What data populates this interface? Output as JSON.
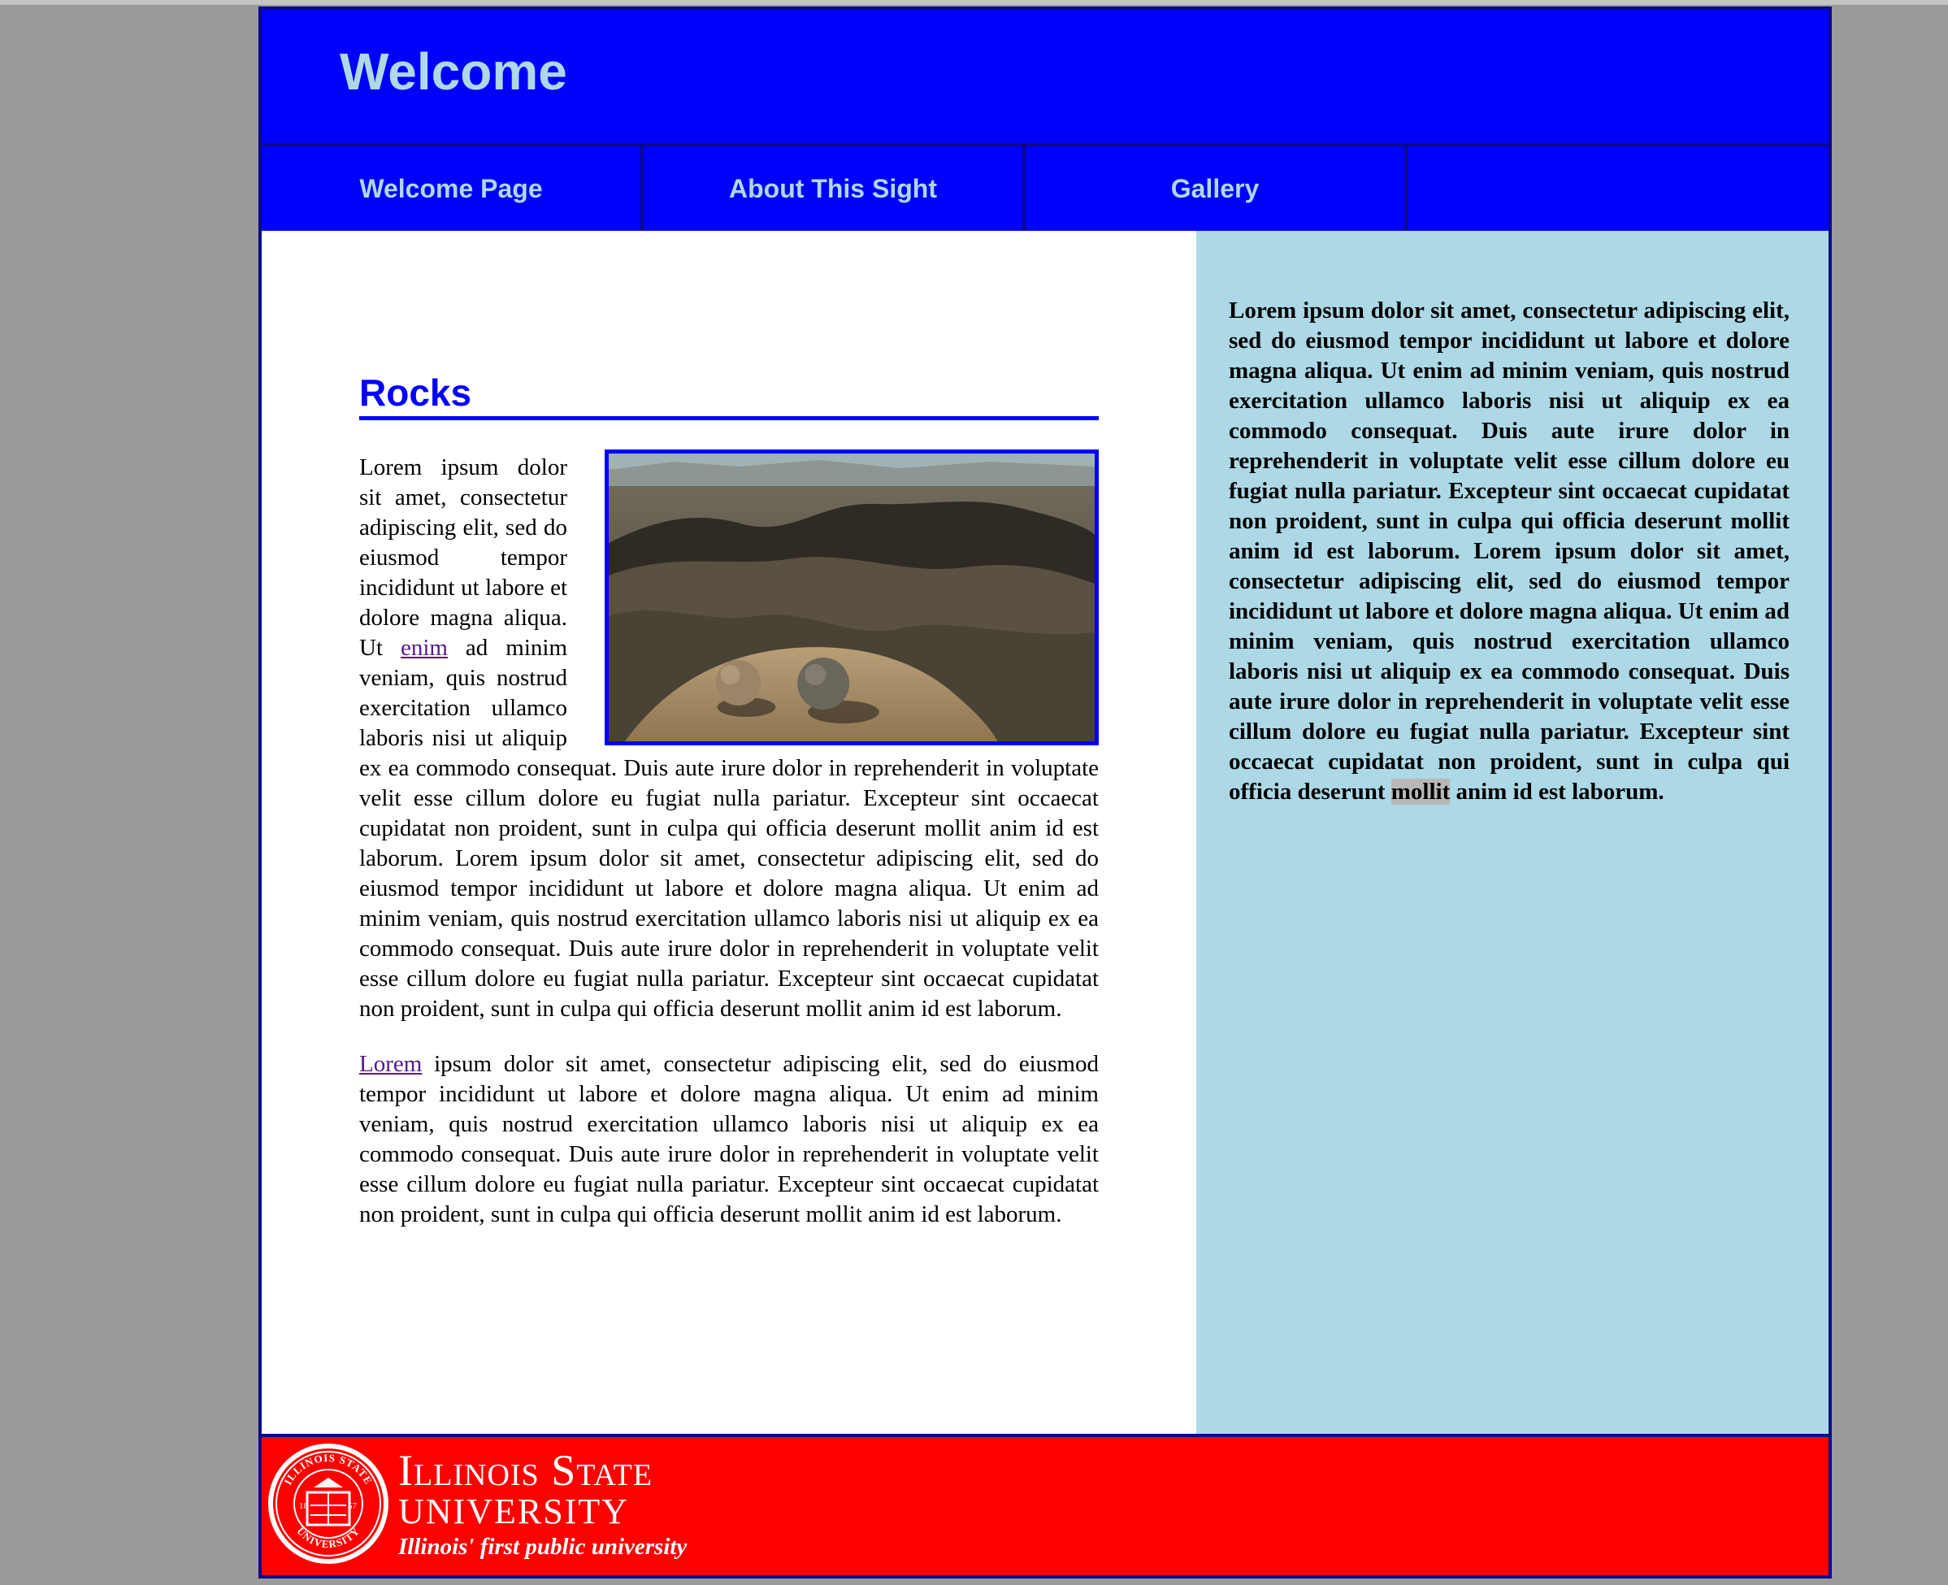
{
  "header": {
    "title": "Welcome"
  },
  "nav": {
    "items": [
      {
        "label": "Welcome Page"
      },
      {
        "label": "About This Sight"
      },
      {
        "label": "Gallery"
      },
      {
        "label": ""
      }
    ]
  },
  "article": {
    "heading": "Rocks",
    "image_alt": "desert badlands with two round rocks",
    "p1": {
      "before_link": "Lorem ipsum dolor sit amet, consectetur adipiscing elit, sed do eiusmod tempor incididunt ut labore et dolore magna aliqua. Ut ",
      "link": "enim",
      "after_link": " ad minim veniam, quis nostrud exercitation ullamco laboris nisi ut aliquip ex ea commodo consequat. Duis aute irure dolor in reprehenderit in voluptate velit esse cillum dolore eu fugiat nulla pariatur. Excepteur sint occaecat cupidatat non proident, sunt in culpa qui officia deserunt mollit anim id est laborum. Lorem ipsum dolor sit amet, consectetur adipiscing elit, sed do eiusmod tempor incididunt ut labore et dolore magna aliqua. Ut enim ad minim veniam, quis nostrud exercitation ullamco laboris nisi ut aliquip ex ea commodo consequat. Duis aute irure dolor in reprehenderit in voluptate velit esse cillum dolore eu fugiat nulla pariatur. Excepteur sint occaecat cupidatat non proident, sunt in culpa qui officia deserunt mollit anim id est laborum."
    },
    "p2": {
      "link": "Lorem",
      "after_link": " ipsum dolor sit amet, consectetur adipiscing elit, sed do eiusmod tempor incididunt ut labore et dolore magna aliqua. Ut enim ad minim veniam, quis nostrud exercitation ullamco laboris nisi ut aliquip ex ea commodo consequat. Duis aute irure dolor in reprehenderit in voluptate velit esse cillum dolore eu fugiat nulla pariatur. Excepteur sint occaecat cupidatat non proident, sunt in culpa qui officia deserunt mollit anim id est laborum."
    }
  },
  "aside": {
    "text_before": "Lorem ipsum dolor sit amet, consectetur adipiscing elit, sed do eiusmod tempor incididunt ut labore et dolore magna aliqua. Ut enim ad minim veniam, quis nostrud exercitation ullamco laboris nisi ut aliquip ex ea commodo consequat. Duis aute irure dolor in reprehenderit in voluptate velit esse cillum dolore eu fugiat nulla pariatur. Excepteur sint occaecat cupidatat non proident, sunt in culpa qui officia deserunt mollit anim id est laborum. Lorem ipsum dolor sit amet, consectetur adipiscing elit, sed do eiusmod tempor incididunt ut labore et dolore magna aliqua. Ut enim ad minim veniam, quis nostrud exercitation ullamco laboris nisi ut aliquip ex ea commodo consequat. Duis aute irure dolor in reprehenderit in voluptate velit esse cillum dolore eu fugiat nulla pariatur. Excepteur sint occaecat cupidatat non proident, sunt in culpa qui officia deserunt ",
    "highlighted": "mollit",
    "text_after": " anim id est laborum."
  },
  "footer": {
    "logo": {
      "line1": "Illinois State",
      "line2": "UNIVERSITY",
      "tagline": "Illinois' first public university",
      "seal_text": "ILLINOIS STATE UNIVERSITY 1857"
    }
  },
  "colors": {
    "header_bg": "#0000ff",
    "header_text": "#add8e6",
    "aside_bg": "#add8e6",
    "footer_bg": "#ff0000",
    "page_bg": "#9a9a9a",
    "border": "#0a0a8a",
    "link": "#551a8b"
  }
}
